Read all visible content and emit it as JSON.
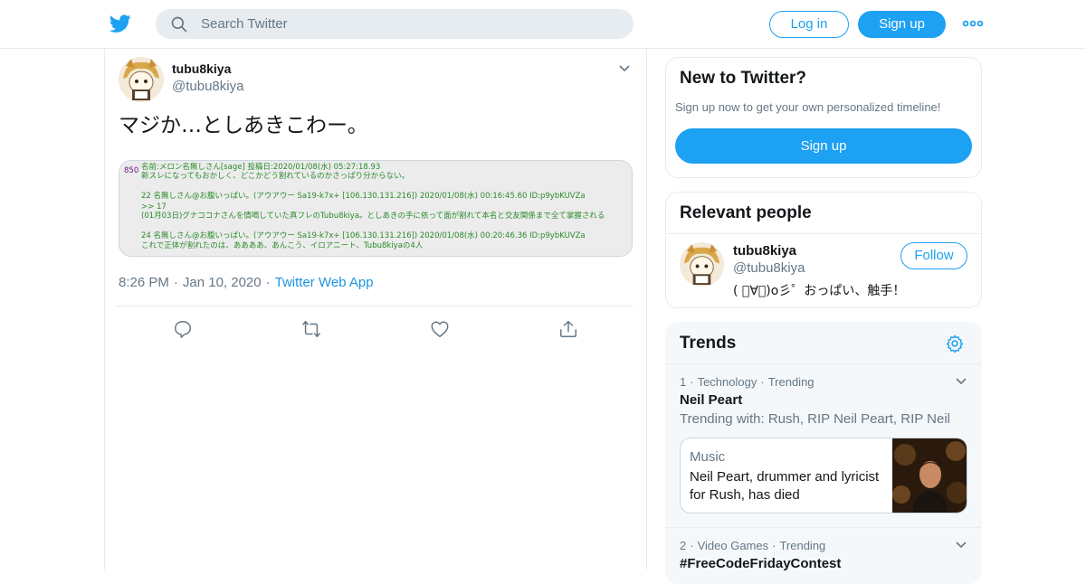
{
  "topbar": {
    "search_placeholder": "Search Twitter",
    "login_label": "Log in",
    "signup_label": "Sign up"
  },
  "tweet": {
    "display_name": "tubu8kiya",
    "handle": "@tubu8kiya",
    "text": "マジか…としあきこわー。",
    "image_lines": [
      "名前:メロン名無しさん[sage] 投稿日:2020/01/08(水) 05:27:18.93",
      "新スレになってもおかしく、どこかどう割れているのかさっぱり分からない。",
      "22 名無しさん@お腹いっぱい。(アウアウー Sa19-k7x+ [106.130.131.216]) 2020/01/08(水) 00:16:45.60 ID:p9ybKUVZa",
      ">> 17",
      "(01月03日)グナココナさんを情喝していた真フレのTubu8kiya。としあきの手に依って面が割れて本名と交友関係まで全て掌握される",
      "24 名無しさん@お腹いっぱい。(アウアウー Sa19-k7x+ [106.130.131.216]) 2020/01/08(水) 00:20:46.36 ID:p9ybKUVZa",
      "これで正体が割れたのは、ああああ、あんこう、イロアニート、Tubu8kiyaの4人"
    ],
    "image_post_number": "850",
    "time": "8:26 PM",
    "date": "Jan 10, 2020",
    "sep": "·",
    "source": "Twitter Web App"
  },
  "sidebar": {
    "new_to_twitter": {
      "title": "New to Twitter?",
      "subtitle": "Sign up now to get your own personalized timeline!",
      "signup_label": "Sign up"
    },
    "relevant": {
      "title": "Relevant people",
      "name": "tubu8kiya",
      "handle": "@tubu8kiya",
      "bio": "( ﾟ∀ﾟ)o彡゜おっぱい、触手！",
      "follow_label": "Follow"
    },
    "trends": {
      "title": "Trends",
      "items": [
        {
          "rank": "1",
          "category": "Technology",
          "status": "Trending",
          "name": "Neil Peart",
          "with": "Trending with: Rush, RIP Neil Peart, RIP Neil",
          "news_category": "Music",
          "news_headline": "Neil Peart, drummer and lyricist for Rush, has died"
        },
        {
          "rank": "2",
          "category": "Video Games",
          "status": "Trending",
          "name": "#FreeCodeFridayContest"
        }
      ]
    }
  },
  "colors": {
    "brand": "#1da1f2",
    "link": "#1b95e0",
    "secondary_text": "#657786",
    "border": "#e6ecf0"
  }
}
